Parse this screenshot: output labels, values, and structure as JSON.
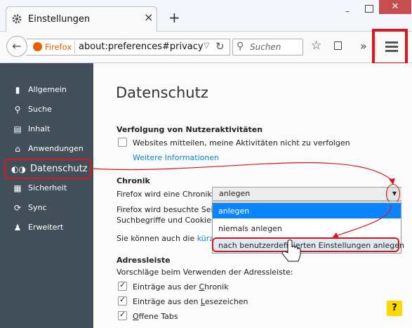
{
  "window": {
    "tab_title": "Einstellungen",
    "tab_close": "×",
    "new_tab": "+",
    "win_min": "–",
    "win_close": "✕"
  },
  "navbar": {
    "back_glyph": "←",
    "firefox_label": "Firefox",
    "url": "about:preferences#privacy",
    "url_dropdown": "▽",
    "reload_glyph": "↻",
    "search_placeholder": "Suchen",
    "overflow": "»"
  },
  "sidebar": {
    "items": [
      {
        "label": "Allgemein",
        "icon": "switch-icon"
      },
      {
        "label": "Suche",
        "icon": "search-icon"
      },
      {
        "label": "Inhalt",
        "icon": "document-icon"
      },
      {
        "label": "Anwendungen",
        "icon": "applications-icon"
      },
      {
        "label": "Datenschutz",
        "icon": "mask-icon"
      },
      {
        "label": "Sicherheit",
        "icon": "lock-icon"
      },
      {
        "label": "Sync",
        "icon": "sync-icon"
      },
      {
        "label": "Erweitert",
        "icon": "wizard-icon"
      }
    ],
    "active_index": 4
  },
  "main": {
    "title": "Datenschutz",
    "tracking": {
      "heading": "Verfolgung von Nutzeraktivitäten",
      "checkbox_label": "Websites mitteilen, meine Aktivitäten nicht zu verfolgen",
      "checked": false,
      "more_info": "Weitere Informationen"
    },
    "history": {
      "heading": "Chronik",
      "label": "Firefox wird eine Chronik:",
      "selected": "anlegen",
      "options": [
        "anlegen",
        "niemals anlegen",
        "nach benutzerdefinierten Einstellungen anlegen"
      ],
      "desc_line1": "Firefox wird besuchte Seiten",
      "desc_line2": "Suchbegriffe und Cookies",
      "desc_line3_prefix": "Sie können auch die",
      "desc_line3_link": "kürzlic"
    },
    "address_bar": {
      "heading": "Adressleiste",
      "desc": "Vorschläge beim Verwenden der Adressleiste:",
      "items": [
        {
          "before": "Einträge aus der ",
          "underlined": "C",
          "after": "hronik",
          "checked": true
        },
        {
          "before": "Einträge aus den ",
          "underlined": "L",
          "after": "esezeichen",
          "checked": true
        },
        {
          "before": "",
          "underlined": "O",
          "after": "ffene Tabs",
          "checked": true
        }
      ]
    },
    "help": "?"
  },
  "colors": {
    "sidebar_bg": "#424f5a",
    "highlight_red": "#d9171c",
    "selected_blue": "#0a84ff",
    "link_blue": "#0a84cc"
  }
}
